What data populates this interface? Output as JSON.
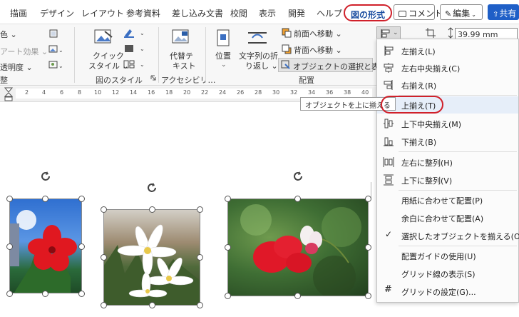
{
  "tabs": [
    {
      "label": "描画"
    },
    {
      "label": "デザイン"
    },
    {
      "label": "レイアウト"
    },
    {
      "label": "参考資料"
    },
    {
      "label": "差し込み文書"
    },
    {
      "label": "校閲"
    },
    {
      "label": "表示"
    },
    {
      "label": "開発"
    },
    {
      "label": "ヘルプ"
    },
    {
      "label": "図の形式"
    }
  ],
  "top_actions": {
    "comment": "コメント",
    "edit": "編集",
    "share": "共有"
  },
  "ribbon": {
    "color": "色",
    "art_effects": "アート効果",
    "transparency": "透明度",
    "adjust_group_partial": "整",
    "quick_style_line1": "クイック",
    "quick_style_line2": "スタイル",
    "picture_styles_group": "図のスタイル",
    "alt_text_line1": "代替テ",
    "alt_text_line2": "キスト",
    "accessibility_group": "アクセシビリ…",
    "position": "位置",
    "wrap_text_line1": "文字列の折",
    "wrap_text_line2": "り返し",
    "bring_forward": "前面へ移動",
    "send_backward": "背面へ移動",
    "selection_pane": "オブジェクトの選択と表示",
    "arrange_group": "配置",
    "width_value": "39.99 mm"
  },
  "ruler_ticks": [
    "2",
    "2",
    "4",
    "6",
    "8",
    "10",
    "12",
    "14",
    "16",
    "18",
    "20",
    "22",
    "24",
    "26",
    "28",
    "30",
    "32",
    "34",
    "36",
    "38",
    "40"
  ],
  "tooltip": "オブジェクトを上に揃える",
  "align_menu": {
    "items": [
      {
        "label": "左揃え(L)",
        "icon": "align-left-icon"
      },
      {
        "label": "左右中央揃え(C)",
        "icon": "align-center-icon"
      },
      {
        "label": "右揃え(R)",
        "icon": "align-right-icon"
      },
      {
        "label": "上揃え(T)",
        "icon": "align-top-icon"
      },
      {
        "label": "上下中央揃え(M)",
        "icon": "align-middle-icon"
      },
      {
        "label": "下揃え(B)",
        "icon": "align-bottom-icon"
      },
      {
        "label": "左右に整列(H)",
        "icon": "distribute-horizontal-icon"
      },
      {
        "label": "上下に整列(V)",
        "icon": "distribute-vertical-icon"
      },
      {
        "label": "用紙に合わせて配置(P)",
        "icon": ""
      },
      {
        "label": "余白に合わせて配置(A)",
        "icon": ""
      },
      {
        "label": "選択したオブジェクトを揃える(O)",
        "icon": "checkmark-icon"
      },
      {
        "label": "配置ガイドの使用(U)",
        "icon": ""
      },
      {
        "label": "グリッド線の表示(S)",
        "icon": ""
      },
      {
        "label": "グリッドの設定(G)...",
        "icon": "grid-icon"
      }
    ]
  },
  "colors": {
    "accent_red": "#d0202a",
    "ribbon_bg": "#f7f7f7",
    "menu_highlight": "#e6eef9",
    "active_tab_text": "#1d4fa1"
  }
}
